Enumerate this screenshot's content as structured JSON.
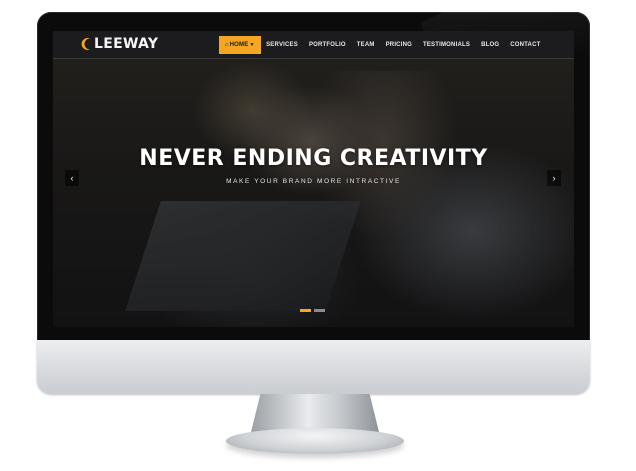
{
  "brand": {
    "name": "LEEWAY",
    "accent_color": "#f5a623"
  },
  "nav": {
    "items": [
      {
        "label": "HOME",
        "active": true,
        "icon": "home-icon"
      },
      {
        "label": "SERVICES",
        "active": false
      },
      {
        "label": "PORTFOLIO",
        "active": false
      },
      {
        "label": "TEAM",
        "active": false
      },
      {
        "label": "PRICING",
        "active": false
      },
      {
        "label": "TESTIMONIALS",
        "active": false
      },
      {
        "label": "BLOG",
        "active": false
      },
      {
        "label": "CONTACT",
        "active": false
      }
    ]
  },
  "hero": {
    "title": "NEVER ENDING CREATIVITY",
    "subtitle": "MAKE YOUR BRAND MORE INTRACTIVE",
    "prev_icon": "chevron-left-icon",
    "next_icon": "chevron-right-icon",
    "slides": [
      {
        "active": true
      },
      {
        "active": false
      }
    ]
  }
}
